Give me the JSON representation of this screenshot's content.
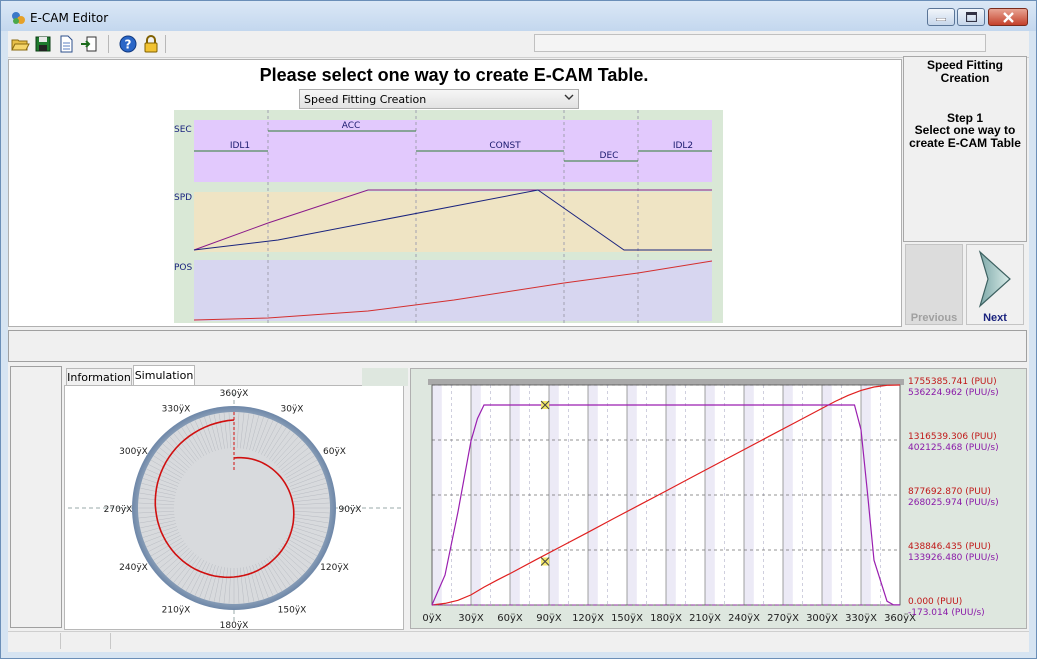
{
  "window": {
    "title": "E-CAM Editor"
  },
  "toolbar": {
    "icons": [
      "open-folder-icon",
      "save-disk-icon",
      "new-document-icon",
      "export-icon",
      "help-icon",
      "lock-icon"
    ],
    "field_value": ""
  },
  "wizard": {
    "heading": "Please select one way to create E-CAM Table.",
    "method_selected": "Speed Fitting Creation",
    "diagram": {
      "row_labels": {
        "sec": "SEC",
        "spd": "SPD",
        "pos": "POS"
      },
      "segments": [
        {
          "label": "IDL1",
          "level": "mid"
        },
        {
          "label": "ACC",
          "level": "high"
        },
        {
          "label": "CONST",
          "level": "mid"
        },
        {
          "label": "DEC",
          "level": "low"
        },
        {
          "label": "IDL2",
          "level": "mid"
        }
      ],
      "colors": {
        "sec": "#e2c9fd",
        "spd": "#efe4c4",
        "pos": "#d7d6f0",
        "bg": "#d9e8d6"
      }
    }
  },
  "step_panel": {
    "title": "Speed Fitting Creation",
    "step": "Step 1",
    "description": "Select one way to create E-CAM Table",
    "prev_label": "Previous",
    "next_label": "Next",
    "prev_enabled": false
  },
  "tabs": [
    {
      "label": "Information",
      "active": false
    },
    {
      "label": "Simulation",
      "active": true
    }
  ],
  "polar": {
    "angle_labels": [
      "360ÿX",
      "30ÿX",
      "60ÿX",
      "90ÿX",
      "120ÿX",
      "150ÿX",
      "180ÿX",
      "210ÿX",
      "240ÿX",
      "270ÿX",
      "300ÿX",
      "330ÿX"
    ]
  },
  "chart_data": {
    "type": "line",
    "x_ticks": [
      "0ÿX",
      "30ÿX",
      "60ÿX",
      "90ÿX",
      "120ÿX",
      "150ÿX",
      "180ÿX",
      "210ÿX",
      "240ÿX",
      "270ÿX",
      "300ÿX",
      "330ÿX",
      "360ÿX"
    ],
    "xlim": [
      0,
      360
    ],
    "pos_ticks": [
      "1755385.741  (PUU)",
      "1316539.306  (PUU)",
      "877692.870  (PUU)",
      "438846.435  (PUU)",
      "0.000  (PUU)"
    ],
    "spd_ticks": [
      "536224.962  (PUU/s)",
      "402125.468  (PUU/s)",
      "268025.974  (PUU/s)",
      "133926.480  (PUU/s)",
      "-173.014  (PUU/s)"
    ],
    "pos_ylim": [
      0.0,
      1755385.741
    ],
    "spd_ylim": [
      -173.014,
      536224.962
    ],
    "series": [
      {
        "color": "#e02020",
        "x": [
          0,
          10,
          20,
          30,
          40,
          50,
          60,
          80,
          100,
          120,
          140,
          160,
          180,
          200,
          220,
          240,
          260,
          280,
          300,
          310,
          320,
          330,
          340,
          350,
          360
        ],
        "y": [
          0,
          20000,
          60000,
          130000,
          230000,
          320000,
          405000,
          583000,
          760000,
          937000,
          1115000,
          1292000,
          1469000,
          1647000,
          1824000,
          2002000,
          2179000,
          2356000,
          2533000,
          2622000,
          2700000,
          2765000,
          2808000,
          2830000,
          2834000
        ]
      },
      {
        "color": "#9a1fb0",
        "x": [
          0,
          10,
          20,
          30,
          35,
          40,
          60,
          90,
          120,
          150,
          180,
          210,
          240,
          270,
          300,
          320,
          325,
          330,
          335,
          340,
          350,
          355,
          360
        ],
        "y": [
          0,
          80000,
          250000,
          440000,
          500000,
          536225,
          536225,
          536225,
          536225,
          536225,
          536225,
          536225,
          536225,
          536225,
          536225,
          536225,
          536225,
          470000,
          300000,
          120000,
          10000,
          0,
          0
        ]
      }
    ],
    "grid": true
  }
}
